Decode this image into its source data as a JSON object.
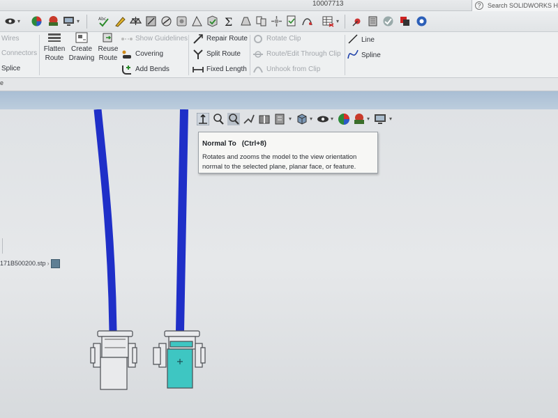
{
  "window": {
    "doc_title": "10007713",
    "search_placeholder": "Search SOLIDWORKS Help"
  },
  "ribbon": {
    "left_col": [
      "Wires",
      "Connectors",
      "Splice"
    ],
    "big_buttons": [
      {
        "line1": "Flatten",
        "line2": "Route"
      },
      {
        "line1": "Create",
        "line2": "Drawing"
      },
      {
        "line1": "Reuse",
        "line2": "Route"
      }
    ],
    "group2": [
      "Show Guidelines",
      "Covering",
      "Add Bends"
    ],
    "group3": [
      "Repair Route",
      "Split Route",
      "Fixed Length"
    ],
    "group4": [
      "Rotate Clip",
      "Route/Edit Through Clip",
      "Unhook from Clip"
    ],
    "group5": [
      "Line",
      "Spline"
    ]
  },
  "tabs": {
    "partial_label": "e"
  },
  "tree": {
    "node_label": "171B500200.stp"
  },
  "tooltip": {
    "title": "Normal To",
    "shortcut": "(Ctrl+8)",
    "line1": "Rotates and zooms the model to the view orientation",
    "line2": "normal to the selected plane, planar face, or feature."
  },
  "colors": {
    "wire": "#1f2fc8",
    "connector_fill_selected": "#3ec6c2",
    "ribbon_bg": "#eef0f1",
    "viewport_bg": "#e2e5e8"
  },
  "icons": {
    "hud": [
      "normal-to-icon",
      "zoom-to-fit-icon",
      "zoom-to-area-icon",
      "previous-view-icon",
      "section-view-icon",
      "dynamic-annotation-view-icon",
      "view-orientation-icon",
      "display-style-icon",
      "hide-show-items-icon",
      "edit-appearance-icon",
      "apply-scene-icon",
      "view-settings-icon"
    ]
  }
}
